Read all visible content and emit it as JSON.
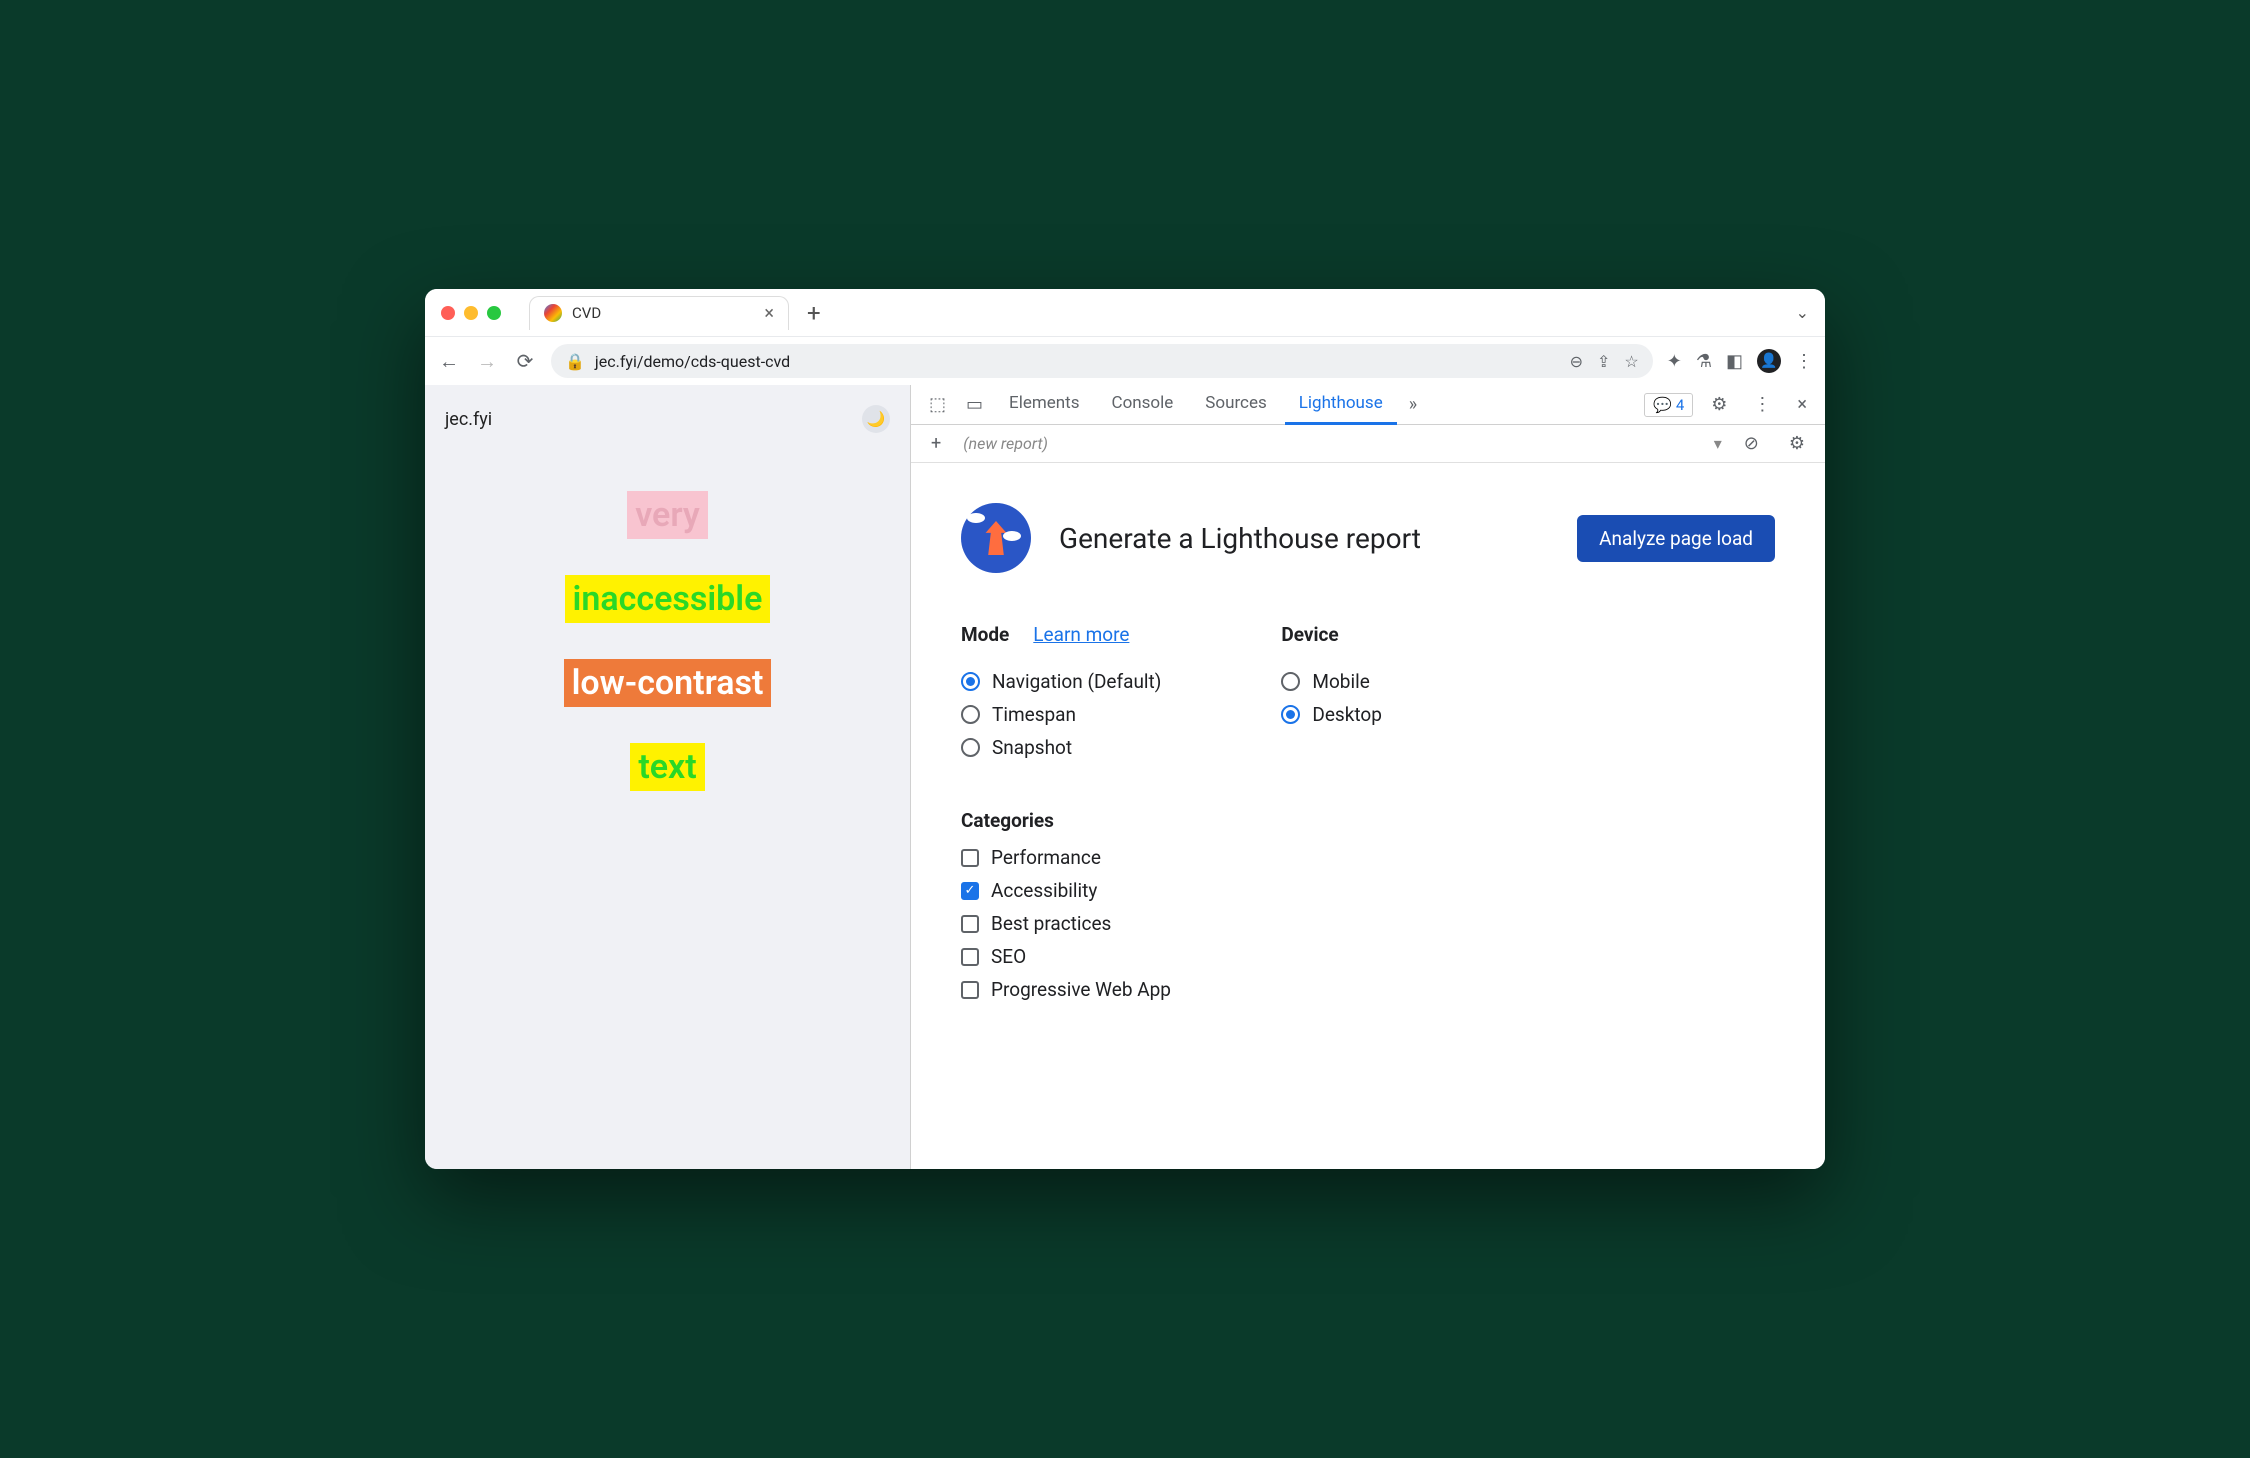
{
  "tab": {
    "title": "CVD"
  },
  "url": "jec.fyi/demo/cds-quest-cvd",
  "page": {
    "brand": "jec.fyi",
    "words": [
      "very",
      "inaccessible",
      "low-contrast",
      "text"
    ]
  },
  "devtools": {
    "tabs": [
      "Elements",
      "Console",
      "Sources",
      "Lighthouse"
    ],
    "active_tab": "Lighthouse",
    "issues_count": "4",
    "subbar": {
      "new_report": "(new report)"
    }
  },
  "lighthouse": {
    "title": "Generate a Lighthouse report",
    "analyze_btn": "Analyze page load",
    "mode": {
      "label": "Mode",
      "learn": "Learn more",
      "options": [
        {
          "label": "Navigation (Default)",
          "checked": true
        },
        {
          "label": "Timespan",
          "checked": false
        },
        {
          "label": "Snapshot",
          "checked": false
        }
      ]
    },
    "device": {
      "label": "Device",
      "options": [
        {
          "label": "Mobile",
          "checked": false
        },
        {
          "label": "Desktop",
          "checked": true
        }
      ]
    },
    "categories": {
      "label": "Categories",
      "options": [
        {
          "label": "Performance",
          "checked": false
        },
        {
          "label": "Accessibility",
          "checked": true
        },
        {
          "label": "Best practices",
          "checked": false
        },
        {
          "label": "SEO",
          "checked": false
        },
        {
          "label": "Progressive Web App",
          "checked": false
        }
      ]
    }
  }
}
